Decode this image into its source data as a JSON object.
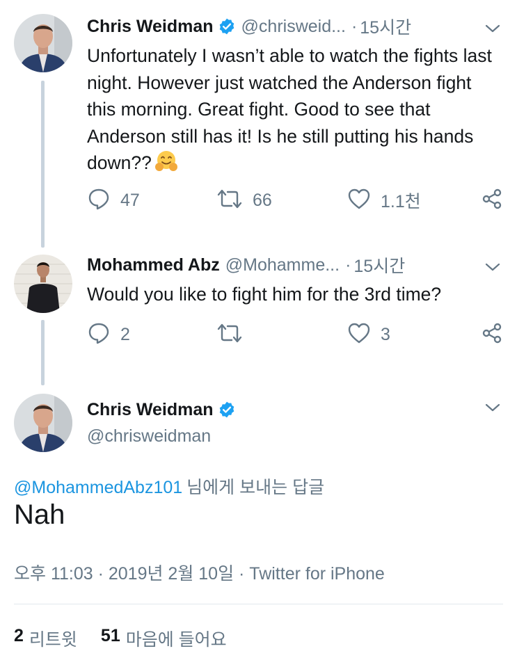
{
  "tweets": [
    {
      "name": "Chris Weidman",
      "handle": "@chrisweid...",
      "dot": "·",
      "time": "15시간",
      "text": "Unfortunately I wasn’t able to watch the fights last night. However just watched the Anderson fight this morning. Great fight. Good to see that Anderson still has it! Is he still putting his hands down??",
      "emoji": "hugging-face",
      "replies": "47",
      "retweets": "66",
      "likes": "1.1천"
    },
    {
      "name": "Mohammed Abz",
      "handle": "@Mohamme...",
      "dot": "·",
      "time": "15시간",
      "text": "Would you like to fight him for the 3rd time?",
      "replies": "2",
      "retweets": "",
      "likes": "3"
    }
  ],
  "main": {
    "name": "Chris Weidman",
    "handle": "@chrisweidman",
    "reply_mention": "@MohammedAbz101",
    "reply_suffix": "님에게 보내는 답글",
    "text": "Nah",
    "meta": "오후 11:03 · 2019년 2월 10일 · Twitter for iPhone",
    "retweet_count": "2",
    "retweet_label": "리트윗",
    "like_count": "51",
    "like_label": "마음에 들어요"
  },
  "icons": {
    "reply": "reply-icon",
    "retweet": "retweet-icon",
    "like": "heart-icon",
    "share": "share-icon",
    "verified": "verified-badge-icon",
    "menu": "chevron-down-icon"
  },
  "colors": {
    "text": "#14171a",
    "secondary": "#657786",
    "link": "#1b95e0",
    "verified": "#1da1f2",
    "thread_line": "#c8d3dd"
  }
}
